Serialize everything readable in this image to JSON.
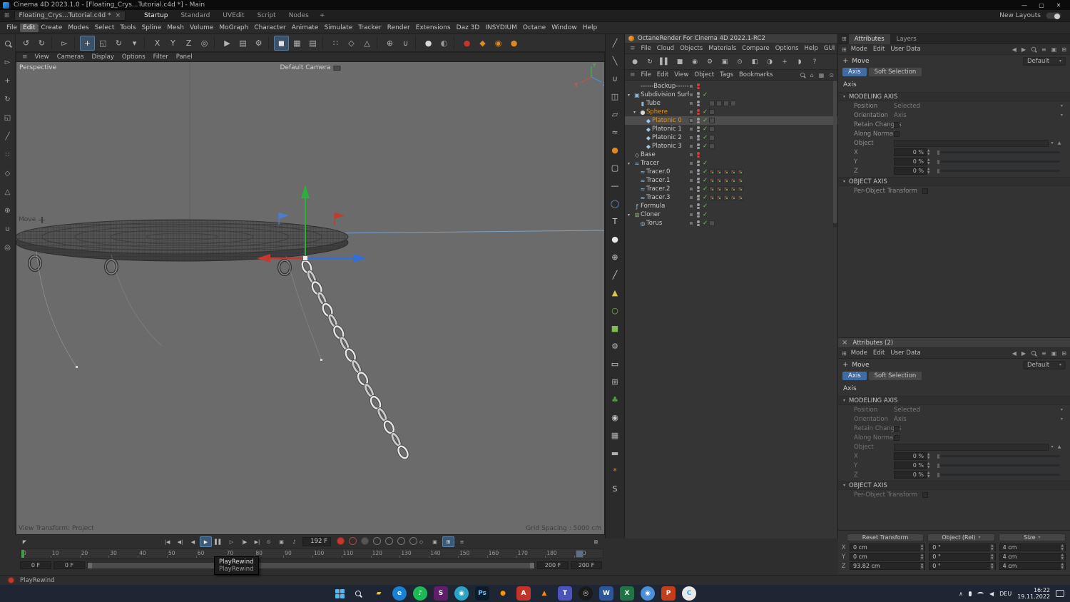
{
  "titlebar": {
    "title": "Cinema 4D 2023.1.0 - [Floating_Crys...Tutorial.c4d *] - Main",
    "minimize": "—",
    "maximize": "▢",
    "close": "✕"
  },
  "layout_bar": {
    "doc_tab": "Floating_Crys...Tutorial.c4d *",
    "close_glyph": "×",
    "layouts": [
      "Startup",
      "Standard",
      "UVEdit",
      "Script",
      "Nodes"
    ],
    "active": "Startup",
    "add_glyph": "+",
    "new_layouts": "New Layouts"
  },
  "menubar": {
    "items": [
      "File",
      "Edit",
      "Create",
      "Modes",
      "Select",
      "Tools",
      "Spline",
      "Mesh",
      "Volume",
      "MoGraph",
      "Character",
      "Animate",
      "Simulate",
      "Tracker",
      "Render",
      "Extensions",
      "Daz 3D",
      "INSYDIUM",
      "Octane",
      "Window",
      "Help"
    ],
    "highlight": "Edit"
  },
  "main_toolbar": [
    {
      "name": "undo-button",
      "g": "↺"
    },
    {
      "name": "redo-button",
      "g": "↻"
    },
    {
      "sep": 1
    },
    {
      "name": "live-selection-tool",
      "g": "▻"
    },
    {
      "sep": 1
    },
    {
      "name": "move-tool",
      "g": "+",
      "active": true
    },
    {
      "name": "scale-tool",
      "g": "◱"
    },
    {
      "name": "rotate-tool",
      "g": "↻"
    },
    {
      "name": "last-used-tools",
      "g": "▾"
    },
    {
      "sep": 1
    },
    {
      "name": "lock-x-axis-button",
      "g": "X"
    },
    {
      "name": "lock-y-axis-button",
      "g": "Y"
    },
    {
      "name": "lock-z-axis-button",
      "g": "Z"
    },
    {
      "name": "coordinate-system-toggle",
      "g": "◎"
    },
    {
      "sep": 1
    },
    {
      "name": "render-view-button",
      "g": "▶"
    },
    {
      "name": "render-picture-viewer-button",
      "g": "▤"
    },
    {
      "name": "render-settings-button",
      "g": "⚙"
    },
    {
      "sep": 1
    },
    {
      "name": "model-mode-button",
      "g": "◼",
      "active": true
    },
    {
      "name": "texture-mode-button",
      "g": "▦"
    },
    {
      "name": "workplane-mode-button",
      "g": "▤"
    },
    {
      "sep": 1
    },
    {
      "name": "points-mode-button",
      "g": "∷"
    },
    {
      "name": "edges-mode-button",
      "g": "◇"
    },
    {
      "name": "polygons-mode-button",
      "g": "△"
    },
    {
      "sep": 1
    },
    {
      "name": "enable-axis-button",
      "g": "⊕"
    },
    {
      "name": "snap-toggle-button",
      "g": "∪"
    },
    {
      "sep": 1
    },
    {
      "name": "material-preview-sphere",
      "g": "●",
      "c": "#d8d8d8"
    },
    {
      "name": "material-preview-sphere-2",
      "g": "◐",
      "c": "#9a9a9a"
    },
    {
      "sep": 1
    },
    {
      "name": "octane-dialog-button",
      "g": "●",
      "c": "#c8352b"
    },
    {
      "name": "octane-live-viewer-button",
      "g": "◆",
      "c": "#e08a1e"
    },
    {
      "name": "octane-render-button",
      "g": "◉",
      "c": "#e08a1e"
    },
    {
      "name": "octane-materials-button",
      "g": "●",
      "c": "#e08a1e"
    }
  ],
  "left_toolbar": [
    {
      "name": "zoom-tool",
      "kind": "lens"
    },
    {
      "name": "selection-tool-side",
      "g": "▻"
    },
    {
      "name": "move-tool-side",
      "g": "+"
    },
    {
      "name": "rotate-tool-side",
      "g": "↻"
    },
    {
      "name": "scale-tool-side",
      "g": "◱"
    },
    {
      "name": "pen-tool-side",
      "g": "╱"
    },
    {
      "name": "points-mode-side",
      "g": "∷"
    },
    {
      "name": "edges-mode-side",
      "g": "◇"
    },
    {
      "name": "polygons-mode-side",
      "g": "△"
    },
    {
      "name": "axis-mode-side",
      "g": "⊕"
    },
    {
      "name": "snap-mode-side",
      "g": "∪"
    },
    {
      "name": "solo-mode-side",
      "g": "◎"
    }
  ],
  "viewport": {
    "menu": [
      "View",
      "Cameras",
      "Display",
      "Options",
      "Filter",
      "Panel"
    ],
    "view_label": "Perspective",
    "camera_label": "Default Camera",
    "tool_label": "Move",
    "footer_left": "View Transform: Project",
    "footer_right": "Grid Spacing : 5000 cm",
    "gizmo": {
      "x": "X",
      "y": "Y",
      "z": "Z"
    }
  },
  "right_strip": [
    {
      "name": "strip-brush-tool",
      "g": "╱"
    },
    {
      "name": "strip-knife-tool",
      "g": "╲"
    },
    {
      "name": "strip-magnet-tool",
      "g": "∪"
    },
    {
      "name": "strip-mirror-tool",
      "g": "◫"
    },
    {
      "name": "strip-projection-tool",
      "g": "▱"
    },
    {
      "name": "strip-smooth-tool",
      "g": "≈"
    },
    {
      "name": "octane-objects-menu",
      "g": "●",
      "c": "#e08a1e"
    },
    {
      "name": "add-cube-object",
      "g": "▢",
      "c": "#d0d0d0"
    },
    {
      "name": "add-spline-object",
      "g": "—",
      "c": "#d0d0d0"
    },
    {
      "name": "add-circle-spline",
      "g": "◯",
      "c": "#6aa0d8"
    },
    {
      "name": "add-text-object",
      "g": "T",
      "c": "#d0d0d0"
    },
    {
      "name": "add-sphere-object",
      "g": "●",
      "c": "#e8e8e8"
    },
    {
      "name": "add-null-object",
      "g": "⊕",
      "c": "#cfcfcf"
    },
    {
      "name": "spline-pen-tool",
      "g": "╱",
      "c": "#cfcfcf"
    },
    {
      "name": "add-pyramid-object",
      "g": "▲",
      "c": "#d8c84a"
    },
    {
      "name": "add-figure-object",
      "g": "○",
      "c": "#7dbf4e"
    },
    {
      "name": "add-cube-green",
      "g": "■",
      "c": "#7dbf4e"
    },
    {
      "name": "add-generator-object",
      "g": "⚙",
      "c": "#b8b8b8"
    },
    {
      "name": "add-capsule-object",
      "g": "▭",
      "c": "#e0e0e0"
    },
    {
      "name": "add-array-object",
      "g": "⊞",
      "c": "#b8b8b8"
    },
    {
      "name": "add-tree-object",
      "g": "♣",
      "c": "#4e9f3f"
    },
    {
      "name": "add-camera-object",
      "g": "◉",
      "c": "#c8c8c8"
    },
    {
      "name": "add-stage-object",
      "g": "▦",
      "c": "#b0b0b0"
    },
    {
      "name": "add-floor-object",
      "g": "▬",
      "c": "#b0b0b0"
    },
    {
      "name": "add-flower-object",
      "g": "*",
      "c": "#e08a1e"
    },
    {
      "name": "add-dynamics-object",
      "g": "S",
      "c": "#c8c8c8"
    }
  ],
  "octane": {
    "title": "OctaneRender For Cinema 4D 2022.1-RC2",
    "menus": [
      "File",
      "Cloud",
      "Objects",
      "Materials",
      "Compare",
      "Options",
      "Help",
      "GUI"
    ],
    "tools": [
      {
        "name": "octane-start-render",
        "g": "●"
      },
      {
        "name": "octane-restart-render",
        "g": "↻"
      },
      {
        "name": "octane-pause-render",
        "g": "▌▌"
      },
      {
        "name": "octane-stop-render",
        "g": "■"
      },
      {
        "name": "octane-camera-lock",
        "g": "◉"
      },
      {
        "name": "octane-kernel-settings",
        "g": "⚙"
      },
      {
        "name": "octane-lock-resolution",
        "g": "▣"
      },
      {
        "name": "octane-focus-picker",
        "g": "⊙"
      },
      {
        "name": "octane-render-region",
        "g": "◧"
      },
      {
        "name": "octane-pick-material",
        "g": "◑"
      },
      {
        "name": "octane-add-node",
        "g": "+"
      },
      {
        "name": "octane-live-chat",
        "g": "◗"
      },
      {
        "name": "octane-help",
        "g": "?"
      }
    ]
  },
  "object_manager": {
    "menus": [
      "File",
      "Edit",
      "View",
      "Object",
      "Tags",
      "Bookmarks"
    ],
    "objects": [
      {
        "name": "------Backup------",
        "depth": 0,
        "glyph": "",
        "dots": "red"
      },
      {
        "name": "Subdivision Surface",
        "depth": 0,
        "arrow": true,
        "glyph": "▣",
        "gc": "#8fb7d9",
        "check": true,
        "dots": "gray"
      },
      {
        "name": "Tube",
        "depth": 1,
        "glyph": "▮",
        "gc": "#8fb7d9",
        "dots": "gray",
        "tags": 4
      },
      {
        "name": "Sphere",
        "depth": 1,
        "arrow": true,
        "glyph": "●",
        "gc": "#dadada",
        "orange": true,
        "check": true,
        "dots": "red",
        "tags": 1
      },
      {
        "name": "Platonic 0",
        "depth": 2,
        "glyph": "◆",
        "gc": "#9ec7e8",
        "orange": true,
        "selected": true,
        "check": true,
        "dots": "gray",
        "tags": 1
      },
      {
        "name": "Platonic 1",
        "depth": 2,
        "glyph": "◆",
        "gc": "#9ec7e8",
        "check": true,
        "dots": "gray",
        "tags": 1
      },
      {
        "name": "Platonic 2",
        "depth": 2,
        "glyph": "◆",
        "gc": "#9ec7e8",
        "check": true,
        "dots": "gray",
        "tags": 1
      },
      {
        "name": "Platonic 3",
        "depth": 2,
        "glyph": "◆",
        "gc": "#9ec7e8",
        "check": true,
        "dots": "gray",
        "tags": 1
      },
      {
        "name": "Base",
        "depth": 0,
        "glyph": "◇",
        "gc": "#bbbbbb",
        "dots": "red"
      },
      {
        "name": "Tracer",
        "depth": 0,
        "arrow": true,
        "glyph": "≈",
        "gc": "#9ec7e8",
        "check": true,
        "dots": "gray"
      },
      {
        "name": "Tracer.0",
        "depth": 1,
        "glyph": "≈",
        "gc": "#9ec7e8",
        "check": true,
        "dots": "gray",
        "tags": 5,
        "tagStyle": "dots"
      },
      {
        "name": "Tracer.1",
        "depth": 1,
        "glyph": "≈",
        "gc": "#9ec7e8",
        "check": true,
        "dots": "gray",
        "tags": 5,
        "tagStyle": "dots"
      },
      {
        "name": "Tracer.2",
        "depth": 1,
        "glyph": "≈",
        "gc": "#9ec7e8",
        "check": true,
        "dots": "gray",
        "tags": 5,
        "tagStyle": "dots"
      },
      {
        "name": "Tracer.3",
        "depth": 1,
        "glyph": "≈",
        "gc": "#9ec7e8",
        "check": true,
        "dots": "gray",
        "tags": 5,
        "tagStyle": "dots"
      },
      {
        "name": "Formula",
        "depth": 0,
        "glyph": "ƒ",
        "gc": "#9ec7e8",
        "check": true,
        "dots": "gray"
      },
      {
        "name": "Cloner",
        "depth": 0,
        "arrow": true,
        "glyph": "⊞",
        "gc": "#86c45a",
        "check": true,
        "dots": "gray"
      },
      {
        "name": "Torus",
        "depth": 1,
        "glyph": "◎",
        "gc": "#9ec7e8",
        "check": true,
        "dots": "gray",
        "tags": 1
      }
    ]
  },
  "om_header_icons": [
    {
      "name": "om-search-icon",
      "kind": "lens"
    },
    {
      "name": "om-home-icon",
      "g": "⌂"
    },
    {
      "name": "om-filter-icon",
      "g": "▦"
    },
    {
      "name": "om-path-icon",
      "g": "⊙"
    }
  ],
  "attr_header_icons": [
    {
      "name": "attr-back-icon",
      "g": "◀"
    },
    {
      "name": "attr-forward-icon",
      "g": "▶"
    },
    {
      "name": "attr-search-icon",
      "kind": "lens"
    },
    {
      "name": "attr-filter-icon",
      "g": "≡"
    },
    {
      "name": "attr-lock-icon",
      "g": "▣"
    },
    {
      "name": "attr-expand-icon",
      "g": "⊞"
    }
  ],
  "attributes": {
    "tabs": [
      "Attributes",
      "Layers"
    ],
    "panel2_title": "Attributes (2)",
    "menus": [
      "Mode",
      "Edit",
      "User Data"
    ],
    "tool_label": "Move",
    "preset": "Default",
    "modes": [
      {
        "label": "Axis",
        "active": true
      },
      {
        "label": "Soft Selection",
        "active": false
      }
    ],
    "heading": "Axis",
    "sections": [
      {
        "title": "MODELING AXIS",
        "rows": [
          {
            "label": "Position",
            "type": "select",
            "value": "Selected"
          },
          {
            "label": "Orientation",
            "type": "select",
            "value": "Axis"
          },
          {
            "label": "Retain Changes",
            "type": "check"
          },
          {
            "label": "Along Normals",
            "type": "check"
          },
          {
            "label": "Object",
            "type": "objfield"
          },
          {
            "label": "X",
            "type": "slider",
            "value": "0 %"
          },
          {
            "label": "Y",
            "type": "slider",
            "value": "0 %"
          },
          {
            "label": "Z",
            "type": "slider",
            "value": "0 %"
          }
        ]
      },
      {
        "title": "OBJECT AXIS",
        "rows": [
          {
            "label": "Per-Object Transform",
            "type": "check",
            "wide": true
          }
        ]
      }
    ]
  },
  "coordinates": {
    "reset": "Reset Transform",
    "object_mode": "Object (Rel)",
    "size_mode": "Size",
    "rows": [
      {
        "axis": "X",
        "position": "0 cm",
        "rotation": "0 °",
        "size": "4 cm"
      },
      {
        "axis": "Y",
        "position": "0 cm",
        "rotation": "0 °",
        "size": "4 cm"
      },
      {
        "axis": "Z",
        "position": "93.82 cm",
        "rotation": "0 °",
        "size": "4 cm"
      }
    ]
  },
  "timeline": {
    "frame_display": "192 F",
    "current_frame": 192,
    "max_frame": 200,
    "tick_labels": [
      "0",
      "10",
      "20",
      "30",
      "40",
      "50",
      "60",
      "70",
      "80",
      "90",
      "100",
      "110",
      "120",
      "130",
      "140",
      "150",
      "160",
      "170",
      "180",
      "190"
    ],
    "range_fields": [
      "0 F",
      "0 F",
      "200 F",
      "200 F"
    ],
    "tooltip_line1": "PlayRewind",
    "tooltip_line2": "PlayRewind",
    "playback": [
      {
        "name": "goto-start-button",
        "g": "|◀"
      },
      {
        "name": "previous-key-button",
        "g": "◀|"
      },
      {
        "name": "previous-frame-button",
        "g": "◀"
      },
      {
        "name": "play-forwards-button",
        "g": "▶",
        "active": true
      },
      {
        "name": "pause-button",
        "g": "▌▌"
      },
      {
        "name": "next-frame-button",
        "g": "▷"
      },
      {
        "name": "next-key-button",
        "g": "|▶"
      },
      {
        "name": "goto-end-button",
        "g": "▶|"
      }
    ],
    "toggles": [
      {
        "name": "solo-animation-toggle",
        "g": "⊙"
      },
      {
        "name": "keyframe-selection-toggle",
        "g": "▣"
      }
    ],
    "sound": {
      "name": "sound-toggle-button",
      "g": "♪"
    },
    "records": [
      {
        "name": "record-keyframe-button",
        "kind": "fill"
      },
      {
        "name": "autokeying-button",
        "kind": "ring"
      },
      {
        "name": "record-position-toggle",
        "kind": "gfill"
      },
      {
        "name": "record-scale-toggle",
        "kind": "gring"
      },
      {
        "name": "record-rotation-toggle",
        "kind": "gring"
      },
      {
        "name": "record-parameter-toggle",
        "kind": "gring"
      },
      {
        "name": "record-pla-toggle",
        "kind": "gring"
      }
    ],
    "key_tools": [
      {
        "name": "keyframe-selection-filter",
        "g": "◇"
      },
      {
        "name": "keyframe-lock-button",
        "g": "▣"
      },
      {
        "name": "auto-key-region-button",
        "g": "⊞",
        "active": true
      },
      {
        "name": "minimal-mode-button",
        "g": "≡"
      }
    ],
    "collapse_glyph": "◤",
    "expand_glyph": "⊠"
  },
  "statusbar": {
    "message": "PlayRewind"
  },
  "taskbar": {
    "lang": "DEU",
    "time": "16:22",
    "date": "19.11.2022",
    "apps": [
      {
        "name": "taskbar-search",
        "kind": "lens"
      },
      {
        "name": "taskbar-file-explorer",
        "glyph": "▰",
        "color": "#e8c14a",
        "bg": "transparent"
      },
      {
        "name": "taskbar-edge",
        "glyph": "e",
        "color": "#ffffff",
        "bg": "#1b7fd4",
        "round": true
      },
      {
        "name": "taskbar-spotify",
        "glyph": "♪",
        "color": "#ffffff",
        "bg": "#1db954",
        "round": true
      },
      {
        "name": "taskbar-slack",
        "glyph": "S",
        "color": "#ffffff",
        "bg": "#611f69"
      },
      {
        "name": "taskbar-compass-browser",
        "glyph": "◉",
        "color": "#ffffff",
        "bg": "#2aa3c8",
        "round": true
      },
      {
        "name": "taskbar-photoshop",
        "glyph": "Ps",
        "color": "#6fc2ff",
        "bg": "#0b1d2c"
      },
      {
        "name": "taskbar-firefox",
        "glyph": "●",
        "color": "#ff9500",
        "bg": "transparent"
      },
      {
        "name": "taskbar-autodesk",
        "glyph": "A",
        "color": "#ffffff",
        "bg": "#c2342a"
      },
      {
        "name": "taskbar-vlc",
        "glyph": "▲",
        "color": "#ff8800",
        "bg": "transparent"
      },
      {
        "name": "taskbar-teams",
        "glyph": "T",
        "color": "#ffffff",
        "bg": "#4b53bc"
      },
      {
        "name": "taskbar-obs",
        "glyph": "◎",
        "color": "#dddddd",
        "bg": "#1a1a1a",
        "round": true
      },
      {
        "name": "taskbar-word",
        "glyph": "W",
        "color": "#ffffff",
        "bg": "#2b579a"
      },
      {
        "name": "taskbar-excel",
        "glyph": "X",
        "color": "#ffffff",
        "bg": "#217346"
      },
      {
        "name": "taskbar-chrome",
        "glyph": "◉",
        "color": "#ffffff",
        "bg": "#4a90d9",
        "round": true
      },
      {
        "name": "taskbar-powerpoint",
        "glyph": "P",
        "color": "#ffffff",
        "bg": "#c43e1c"
      },
      {
        "name": "taskbar-cinema4d",
        "glyph": "C",
        "color": "#3aa0e8",
        "bg": "#e8e8e8",
        "round": true
      }
    ]
  }
}
